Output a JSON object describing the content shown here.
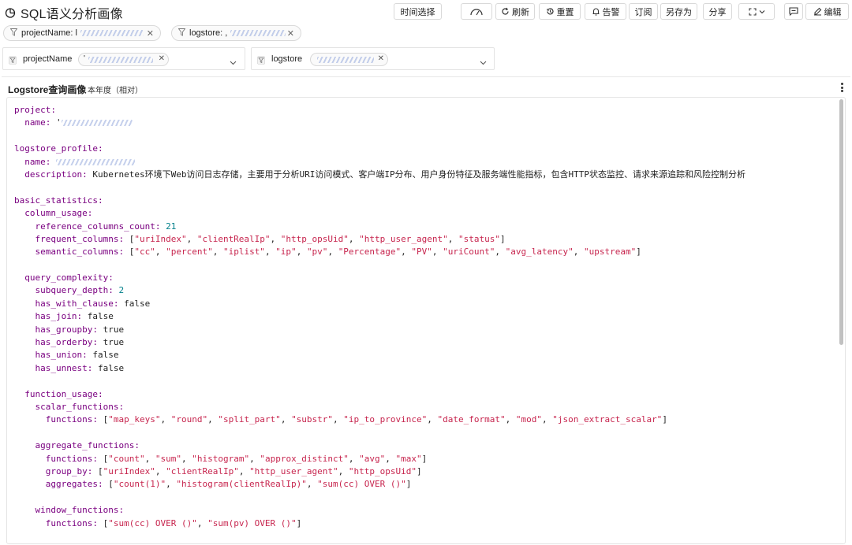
{
  "header": {
    "title": "SQL语义分析画像",
    "icon": "pie-chart-icon"
  },
  "toolbar": {
    "time_select": "时间选择",
    "refresh": "刷新",
    "reset": "重置",
    "alert": "告警",
    "subscribe": "订阅",
    "save_as": "另存为",
    "share": "分享",
    "edit": "编辑"
  },
  "filters": {
    "project_chip": "projectName: l",
    "logstore_chip": "logstore: ,",
    "project_var_label": "projectName",
    "project_var_value": "'",
    "logstore_var_label": "logstore"
  },
  "panel": {
    "title": "Logstore查询画像",
    "subtitle": "本年度（相对）"
  },
  "code_lines": [
    [
      {
        "t": "k",
        "v": "project:"
      }
    ],
    [
      {
        "t": "p",
        "v": "  "
      },
      {
        "t": "k",
        "v": "name:"
      },
      {
        "t": "p",
        "v": " '"
      },
      {
        "t": "b",
        "v": ""
      }
    ],
    [],
    [
      {
        "t": "k",
        "v": "logstore_profile:"
      }
    ],
    [
      {
        "t": "p",
        "v": "  "
      },
      {
        "t": "k",
        "v": "name:"
      },
      {
        "t": "p",
        "v": " "
      },
      {
        "t": "b",
        "v": ""
      }
    ],
    [
      {
        "t": "p",
        "v": "  "
      },
      {
        "t": "k",
        "v": "description:"
      },
      {
        "t": "p",
        "v": " Kubernetes环境下Web访问日志存储，主要用于分析URI访问模式、客户端IP分布、用户身份特征及服务端性能指标，包含HTTP状态监控、请求来源追踪和风险控制分析"
      }
    ],
    [],
    [
      {
        "t": "k",
        "v": "basic_statistics:"
      }
    ],
    [
      {
        "t": "p",
        "v": "  "
      },
      {
        "t": "k",
        "v": "column_usage:"
      }
    ],
    [
      {
        "t": "p",
        "v": "    "
      },
      {
        "t": "k",
        "v": "reference_columns_count:"
      },
      {
        "t": "p",
        "v": " "
      },
      {
        "t": "n",
        "v": "21"
      }
    ],
    [
      {
        "t": "p",
        "v": "    "
      },
      {
        "t": "k",
        "v": "frequent_columns:"
      },
      {
        "t": "p",
        "v": " ["
      },
      {
        "t": "s",
        "v": "\"uriIndex\""
      },
      {
        "t": "p",
        "v": ", "
      },
      {
        "t": "s",
        "v": "\"clientRealIp\""
      },
      {
        "t": "p",
        "v": ", "
      },
      {
        "t": "s",
        "v": "\"http_opsUid\""
      },
      {
        "t": "p",
        "v": ", "
      },
      {
        "t": "s",
        "v": "\"http_user_agent\""
      },
      {
        "t": "p",
        "v": ", "
      },
      {
        "t": "s",
        "v": "\"status\""
      },
      {
        "t": "p",
        "v": "]"
      }
    ],
    [
      {
        "t": "p",
        "v": "    "
      },
      {
        "t": "k",
        "v": "semantic_columns:"
      },
      {
        "t": "p",
        "v": " ["
      },
      {
        "t": "s",
        "v": "\"cc\""
      },
      {
        "t": "p",
        "v": ", "
      },
      {
        "t": "s",
        "v": "\"percent\""
      },
      {
        "t": "p",
        "v": ", "
      },
      {
        "t": "s",
        "v": "\"iplist\""
      },
      {
        "t": "p",
        "v": ", "
      },
      {
        "t": "s",
        "v": "\"ip\""
      },
      {
        "t": "p",
        "v": ", "
      },
      {
        "t": "s",
        "v": "\"pv\""
      },
      {
        "t": "p",
        "v": ", "
      },
      {
        "t": "s",
        "v": "\"Percentage\""
      },
      {
        "t": "p",
        "v": ", "
      },
      {
        "t": "s",
        "v": "\"PV\""
      },
      {
        "t": "p",
        "v": ", "
      },
      {
        "t": "s",
        "v": "\"uriCount\""
      },
      {
        "t": "p",
        "v": ", "
      },
      {
        "t": "s",
        "v": "\"avg_latency\""
      },
      {
        "t": "p",
        "v": ", "
      },
      {
        "t": "s",
        "v": "\"upstream\""
      },
      {
        "t": "p",
        "v": "]"
      }
    ],
    [],
    [
      {
        "t": "p",
        "v": "  "
      },
      {
        "t": "k",
        "v": "query_complexity:"
      }
    ],
    [
      {
        "t": "p",
        "v": "    "
      },
      {
        "t": "k",
        "v": "subquery_depth:"
      },
      {
        "t": "p",
        "v": " "
      },
      {
        "t": "n",
        "v": "2"
      }
    ],
    [
      {
        "t": "p",
        "v": "    "
      },
      {
        "t": "k",
        "v": "has_with_clause:"
      },
      {
        "t": "p",
        "v": " false"
      }
    ],
    [
      {
        "t": "p",
        "v": "    "
      },
      {
        "t": "k",
        "v": "has_join:"
      },
      {
        "t": "p",
        "v": " false"
      }
    ],
    [
      {
        "t": "p",
        "v": "    "
      },
      {
        "t": "k",
        "v": "has_groupby:"
      },
      {
        "t": "p",
        "v": " true"
      }
    ],
    [
      {
        "t": "p",
        "v": "    "
      },
      {
        "t": "k",
        "v": "has_orderby:"
      },
      {
        "t": "p",
        "v": " true"
      }
    ],
    [
      {
        "t": "p",
        "v": "    "
      },
      {
        "t": "k",
        "v": "has_union:"
      },
      {
        "t": "p",
        "v": " false"
      }
    ],
    [
      {
        "t": "p",
        "v": "    "
      },
      {
        "t": "k",
        "v": "has_unnest:"
      },
      {
        "t": "p",
        "v": " false"
      }
    ],
    [],
    [
      {
        "t": "p",
        "v": "  "
      },
      {
        "t": "k",
        "v": "function_usage:"
      }
    ],
    [
      {
        "t": "p",
        "v": "    "
      },
      {
        "t": "k",
        "v": "scalar_functions:"
      }
    ],
    [
      {
        "t": "p",
        "v": "      "
      },
      {
        "t": "k",
        "v": "functions:"
      },
      {
        "t": "p",
        "v": " ["
      },
      {
        "t": "s",
        "v": "\"map_keys\""
      },
      {
        "t": "p",
        "v": ", "
      },
      {
        "t": "s",
        "v": "\"round\""
      },
      {
        "t": "p",
        "v": ", "
      },
      {
        "t": "s",
        "v": "\"split_part\""
      },
      {
        "t": "p",
        "v": ", "
      },
      {
        "t": "s",
        "v": "\"substr\""
      },
      {
        "t": "p",
        "v": ", "
      },
      {
        "t": "s",
        "v": "\"ip_to_province\""
      },
      {
        "t": "p",
        "v": ", "
      },
      {
        "t": "s",
        "v": "\"date_format\""
      },
      {
        "t": "p",
        "v": ", "
      },
      {
        "t": "s",
        "v": "\"mod\""
      },
      {
        "t": "p",
        "v": ", "
      },
      {
        "t": "s",
        "v": "\"json_extract_scalar\""
      },
      {
        "t": "p",
        "v": "]"
      }
    ],
    [],
    [
      {
        "t": "p",
        "v": "    "
      },
      {
        "t": "k",
        "v": "aggregate_functions:"
      }
    ],
    [
      {
        "t": "p",
        "v": "      "
      },
      {
        "t": "k",
        "v": "functions:"
      },
      {
        "t": "p",
        "v": " ["
      },
      {
        "t": "s",
        "v": "\"count\""
      },
      {
        "t": "p",
        "v": ", "
      },
      {
        "t": "s",
        "v": "\"sum\""
      },
      {
        "t": "p",
        "v": ", "
      },
      {
        "t": "s",
        "v": "\"histogram\""
      },
      {
        "t": "p",
        "v": ", "
      },
      {
        "t": "s",
        "v": "\"approx_distinct\""
      },
      {
        "t": "p",
        "v": ", "
      },
      {
        "t": "s",
        "v": "\"avg\""
      },
      {
        "t": "p",
        "v": ", "
      },
      {
        "t": "s",
        "v": "\"max\""
      },
      {
        "t": "p",
        "v": "]"
      }
    ],
    [
      {
        "t": "p",
        "v": "      "
      },
      {
        "t": "k",
        "v": "group_by:"
      },
      {
        "t": "p",
        "v": " ["
      },
      {
        "t": "s",
        "v": "\"uriIndex\""
      },
      {
        "t": "p",
        "v": ", "
      },
      {
        "t": "s",
        "v": "\"clientRealIp\""
      },
      {
        "t": "p",
        "v": ", "
      },
      {
        "t": "s",
        "v": "\"http_user_agent\""
      },
      {
        "t": "p",
        "v": ", "
      },
      {
        "t": "s",
        "v": "\"http_opsUid\""
      },
      {
        "t": "p",
        "v": "]"
      }
    ],
    [
      {
        "t": "p",
        "v": "      "
      },
      {
        "t": "k",
        "v": "aggregates:"
      },
      {
        "t": "p",
        "v": " ["
      },
      {
        "t": "s",
        "v": "\"count(1)\""
      },
      {
        "t": "p",
        "v": ", "
      },
      {
        "t": "s",
        "v": "\"histogram(clientRealIp)\""
      },
      {
        "t": "p",
        "v": ", "
      },
      {
        "t": "s",
        "v": "\"sum(cc) OVER ()\""
      },
      {
        "t": "p",
        "v": "]"
      }
    ],
    [],
    [
      {
        "t": "p",
        "v": "    "
      },
      {
        "t": "k",
        "v": "window_functions:"
      }
    ],
    [
      {
        "t": "p",
        "v": "      "
      },
      {
        "t": "k",
        "v": "functions:"
      },
      {
        "t": "p",
        "v": " ["
      },
      {
        "t": "s",
        "v": "\"sum(cc) OVER ()\""
      },
      {
        "t": "p",
        "v": ", "
      },
      {
        "t": "s",
        "v": "\"sum(pv) OVER ()\""
      },
      {
        "t": "p",
        "v": "]"
      }
    ]
  ]
}
